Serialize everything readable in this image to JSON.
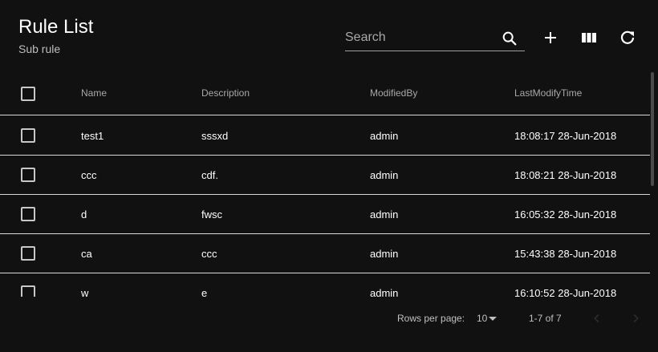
{
  "header": {
    "title": "Rule List",
    "subtitle": "Sub rule"
  },
  "search": {
    "placeholder": "Search",
    "value": "",
    "icon": "search-icon"
  },
  "toolbar": {
    "add_icon": "plus-icon",
    "columns_icon": "view-columns-icon",
    "refresh_icon": "refresh-icon"
  },
  "table": {
    "columns": [
      "Name",
      "Description",
      "ModifiedBy",
      "LastModifyTime"
    ],
    "rows": [
      {
        "name": "test1",
        "description": "sssxd",
        "modified_by": "admin",
        "last_modify_time": "18:08:17 28-Jun-2018"
      },
      {
        "name": "ccc",
        "description": "cdf.",
        "modified_by": "admin",
        "last_modify_time": "18:08:21 28-Jun-2018"
      },
      {
        "name": "d",
        "description": "fwsc",
        "modified_by": "admin",
        "last_modify_time": "16:05:32 28-Jun-2018"
      },
      {
        "name": "ca",
        "description": "ccc",
        "modified_by": "admin",
        "last_modify_time": "15:43:38 28-Jun-2018"
      },
      {
        "name": "w",
        "description": "e",
        "modified_by": "admin",
        "last_modify_time": "16:10:52 28-Jun-2018"
      }
    ]
  },
  "pagination": {
    "rows_per_page_label": "Rows per page:",
    "rows_per_page_value": "10",
    "range_text": "1-7 of 7"
  },
  "colors": {
    "background": "#111111",
    "text": "#ffffff",
    "muted_text": "#a8a8a8",
    "divider": "#d9d9d9"
  }
}
